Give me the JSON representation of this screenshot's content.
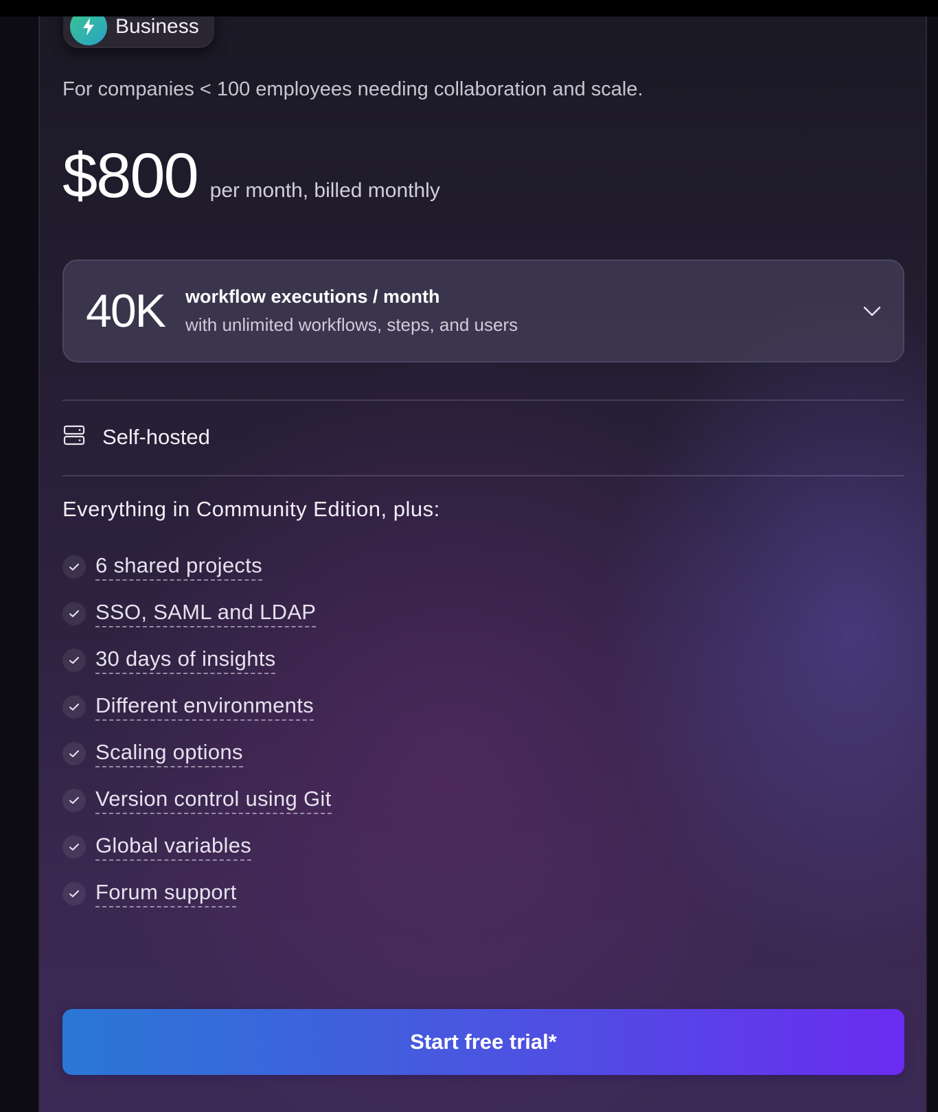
{
  "plan": {
    "badge_label": "Business",
    "badge_icon": "lightning-icon",
    "description": "For companies < 100 employees needing collaboration and scale.",
    "price": "$800",
    "period": "per month, billed monthly"
  },
  "tier": {
    "count": "40K",
    "main": "workflow executions / month",
    "sub": "with unlimited workflows, steps, and users"
  },
  "hosting": {
    "icon": "server-icon",
    "label": "Self-hosted"
  },
  "features": {
    "title": "Everything in Community Edition, plus:",
    "items": [
      "6 shared projects",
      "SSO, SAML and LDAP",
      "30 days of insights",
      "Different environments",
      "Scaling options",
      "Version control using Git",
      "Global variables",
      "Forum support"
    ]
  },
  "cta": {
    "label": "Start free trial*"
  },
  "colors": {
    "cta_start": "#2a78d6",
    "cta_end": "#6a2cf0",
    "badge_icon_start": "#3ac58e",
    "badge_icon_end": "#2aa3c5"
  }
}
